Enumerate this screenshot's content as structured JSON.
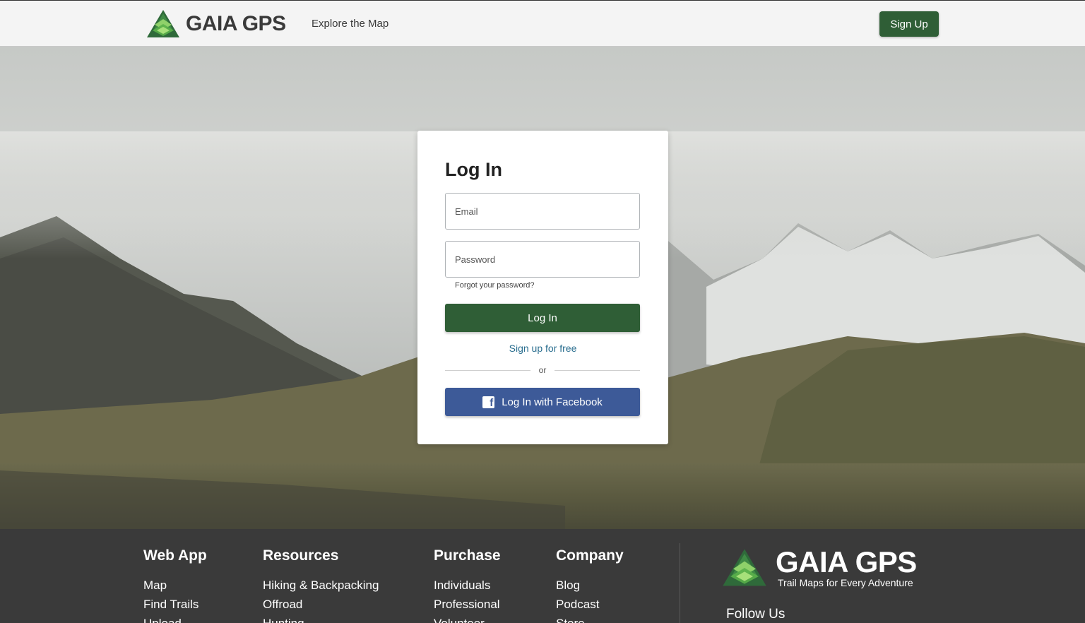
{
  "header": {
    "logo_text": "GAIA GPS",
    "nav_explore": "Explore the Map",
    "signup_label": "Sign Up"
  },
  "login": {
    "title": "Log In",
    "email_placeholder": "Email",
    "password_placeholder": "Password",
    "forgot_label": "Forgot your password?",
    "login_button": "Log In",
    "signup_free": "Sign up for free",
    "or_label": "or",
    "facebook_button": "Log In with Facebook"
  },
  "footer": {
    "columns": [
      {
        "title": "Web App",
        "links": [
          "Map",
          "Find Trails",
          "Upload"
        ]
      },
      {
        "title": "Resources",
        "links": [
          "Hiking & Backpacking",
          "Offroad",
          "Hunting"
        ]
      },
      {
        "title": "Purchase",
        "links": [
          "Individuals",
          "Professional",
          "Volunteer"
        ]
      },
      {
        "title": "Company",
        "links": [
          "Blog",
          "Podcast",
          "Store"
        ]
      }
    ],
    "brand_name": "GAIA GPS",
    "tagline": "Trail Maps for Every Adventure",
    "follow_us": "Follow Us"
  },
  "colors": {
    "brand_green": "#2f5e36",
    "facebook_blue": "#3d5a98",
    "link_blue": "#2a6e8f",
    "footer_bg": "#3a3a3a"
  }
}
